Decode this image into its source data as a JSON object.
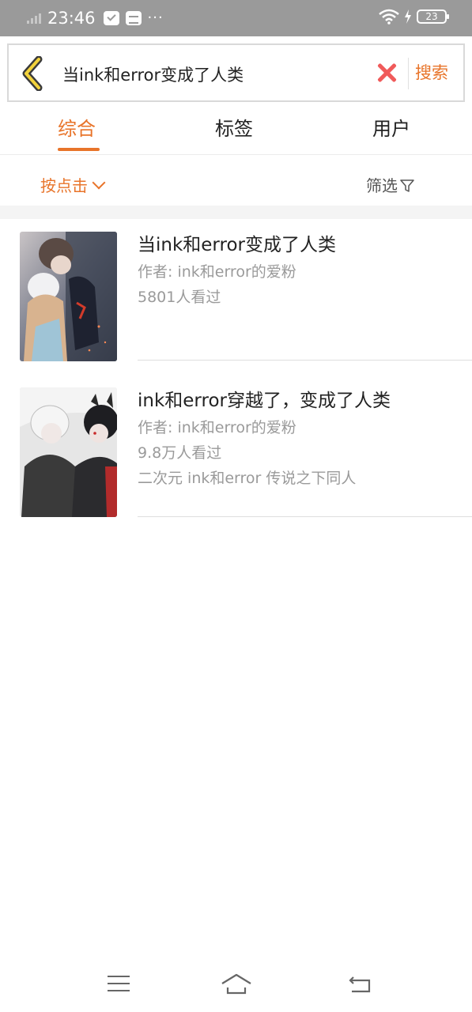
{
  "status_bar": {
    "time": "23:46",
    "dots": "···",
    "battery": "23"
  },
  "search": {
    "query": "当ink和error变成了人类",
    "button_label": "搜索",
    "icons": {
      "back": "chevron-left-icon",
      "clear": "close-icon"
    }
  },
  "tabs": [
    {
      "label": "综合",
      "active": true
    },
    {
      "label": "标签",
      "active": false
    },
    {
      "label": "用户",
      "active": false
    }
  ],
  "sort": {
    "label": "按点击",
    "filter_label": "筛选"
  },
  "results": [
    {
      "title": "当ink和error变成了人类",
      "author": "作者: ink和error的爱粉",
      "views": "5801人看过",
      "tags": ""
    },
    {
      "title": "ink和error穿越了，变成了人类",
      "author": "作者: ink和error的爱粉",
      "views": "9.8万人看过",
      "tags": "二次元 ink和error 传说之下同人"
    }
  ],
  "colors": {
    "accent": "#e8742a",
    "clear": "#f05a5a",
    "status_bar": "#9a9a9a",
    "meta_text": "#9a9a9a"
  }
}
